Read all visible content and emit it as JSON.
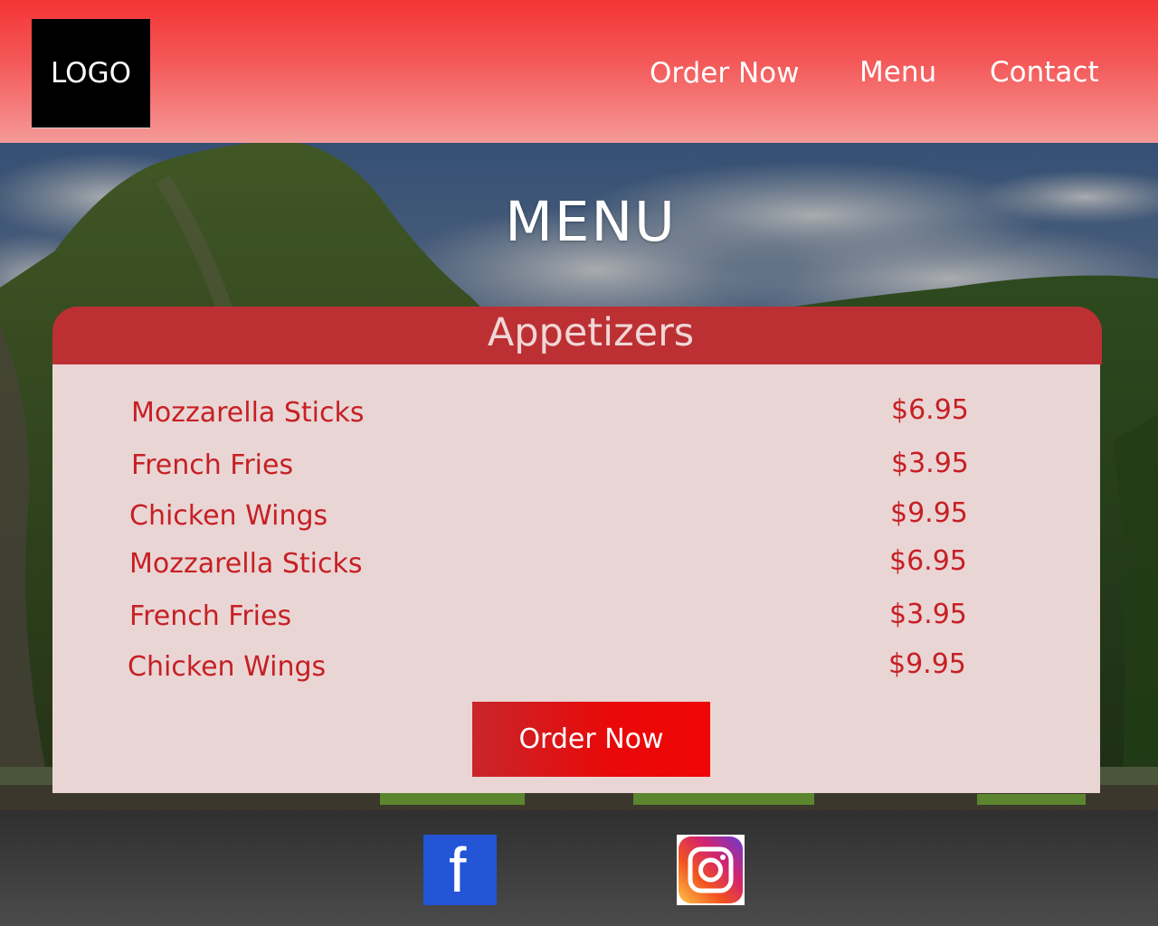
{
  "header": {
    "logo": "LOGO",
    "nav": {
      "order_now": "Order Now",
      "menu": "Menu",
      "contact": "Contact"
    }
  },
  "hero": {
    "title": "MENU"
  },
  "menu_card": {
    "heading": "Appetizers",
    "items": [
      {
        "name": "Mozzarella Sticks",
        "price": "$6.95"
      },
      {
        "name": "French Fries",
        "price": "$3.95"
      },
      {
        "name": "Chicken Wings",
        "price": "$9.95"
      },
      {
        "name": "Mozzarella Sticks",
        "price": "$6.95"
      },
      {
        "name": "French Fries",
        "price": "$3.95"
      },
      {
        "name": "Chicken Wings",
        "price": "$9.95"
      }
    ],
    "order_button": "Order Now"
  },
  "footer": {
    "facebook_icon": "facebook-icon",
    "facebook_letter": "f",
    "instagram_icon": "instagram-icon"
  },
  "colors": {
    "header_red": "#f43434",
    "card_header": "#bc3034",
    "card_body": "#ead5d5",
    "item_text": "#c62024",
    "button_red": "#ea0808",
    "facebook_blue": "#2355d6",
    "footer_dark": "#3a3a3a"
  }
}
